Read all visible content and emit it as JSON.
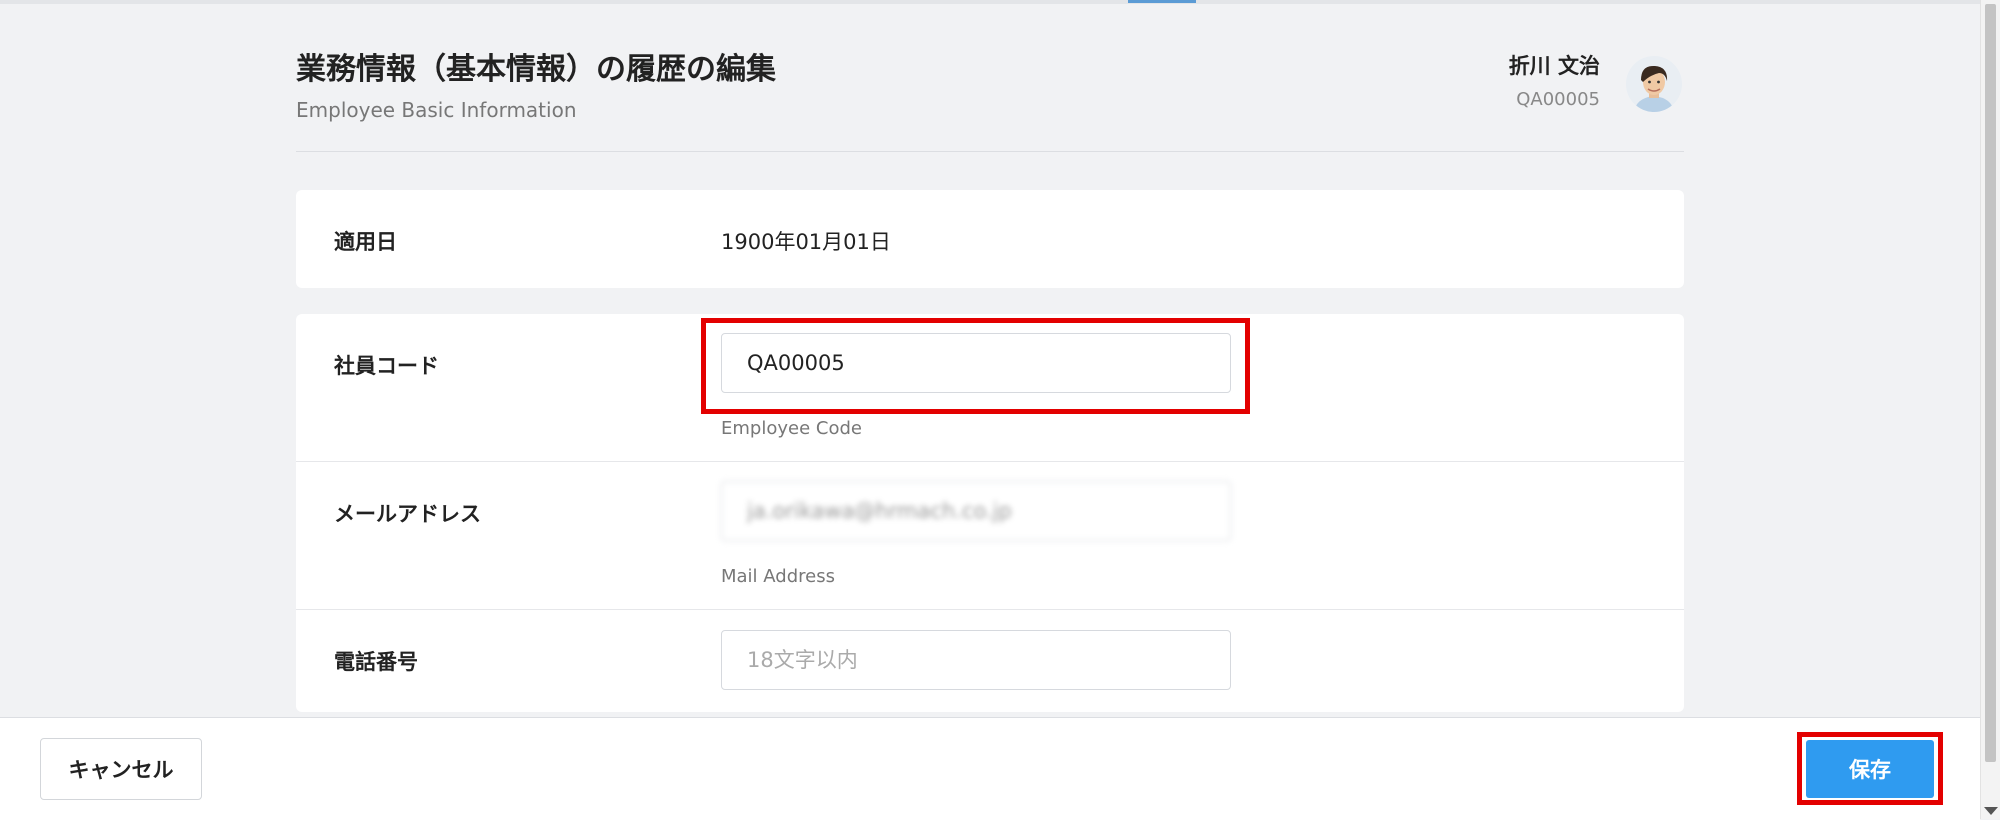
{
  "header": {
    "title": "業務情報（基本情報）の履歴の編集",
    "subtitle": "Employee Basic Information"
  },
  "user": {
    "name": "折川 文治",
    "code": "QA00005",
    "avatar_icon": "avatar-photo"
  },
  "effective_date": {
    "label": "適用日",
    "value": "1900年01月01日"
  },
  "form": {
    "employee_code": {
      "label": "社員コード",
      "value": "QA00005",
      "help": "Employee Code"
    },
    "mail_address": {
      "label": "メールアドレス",
      "value": "ja.orikawa@hrmach.co.jp",
      "help": "Mail Address"
    },
    "phone": {
      "label": "電話番号",
      "value": "",
      "placeholder": "18文字以内"
    }
  },
  "footer": {
    "cancel_label": "キャンセル",
    "save_label": "保存"
  },
  "colors": {
    "accent": "#2f9bf0",
    "highlight": "#e30000",
    "background": "#f1f2f4"
  }
}
